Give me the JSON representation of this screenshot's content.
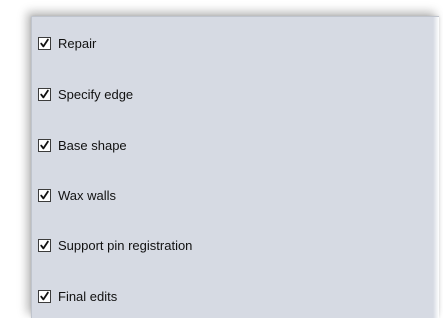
{
  "steps": [
    {
      "label": "Repair",
      "checked": true
    },
    {
      "label": "Specify edge",
      "checked": true
    },
    {
      "label": "Base shape",
      "checked": true
    },
    {
      "label": "Wax walls",
      "checked": true
    },
    {
      "label": "Support pin registration",
      "checked": true
    },
    {
      "label": "Final edits",
      "checked": true
    }
  ],
  "icons": {
    "check": "check-icon"
  }
}
